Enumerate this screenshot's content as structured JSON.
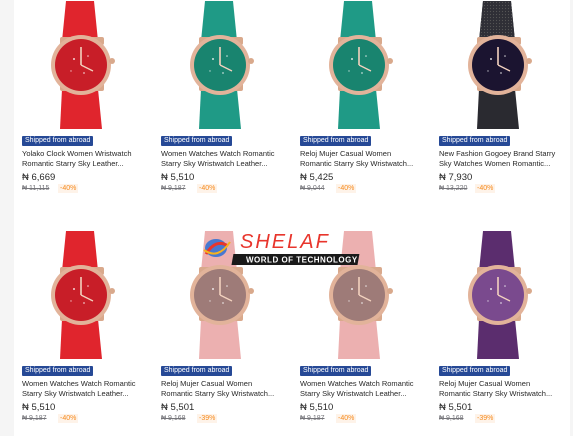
{
  "currency_symbol": "₦",
  "badge_label": "Shipped from abroad",
  "watermark": {
    "brand": "SHELAF",
    "tagline": "WORLD OF TECHNOLOGY"
  },
  "products": [
    {
      "title": "Yolako Clock Women Wristwatch Romantic Starry Sky Leather...",
      "price": "₦ 6,669",
      "old_price": "₦ 11,115",
      "discount": "-40%",
      "strap_color": "#e0252d",
      "dial_color": "#c81e28"
    },
    {
      "title": "Women Watches Watch Romantic Starry Sky Wristwatch Leather...",
      "price": "₦ 5,510",
      "old_price": "₦ 9,187",
      "discount": "-40%",
      "strap_color": "#1f9a86",
      "dial_color": "#19846f"
    },
    {
      "title": "Reloj Mujer Casual Women Romantic Starry Sky Wristwatch...",
      "price": "₦ 5,425",
      "old_price": "₦ 9,044",
      "discount": "-40%",
      "strap_color": "#1f9a86",
      "dial_color": "#19846f"
    },
    {
      "title": "New Fashion Gogoey Brand Starry Sky Watches Women Romantic...",
      "price": "₦ 7,930",
      "old_price": "₦ 13,220",
      "discount": "-40%",
      "strap_color": "#2a2a30",
      "dial_color": "#1b1430"
    },
    {
      "title": "Women Watches Watch Romantic Starry Sky Wristwatch Leather...",
      "price": "₦ 5,510",
      "old_price": "₦ 9,187",
      "discount": "-40%",
      "strap_color": "#e0252d",
      "dial_color": "#c81e28"
    },
    {
      "title": "Reloj Mujer Casual Women Romantic Starry Sky Wristwatch...",
      "price": "₦ 5,501",
      "old_price": "₦ 9,168",
      "discount": "-39%",
      "strap_color": "#ecb0b0",
      "dial_color": "#9e7b78"
    },
    {
      "title": "Women Watches Watch Romantic Starry Sky Wristwatch Leather...",
      "price": "₦ 5,510",
      "old_price": "₦ 9,187",
      "discount": "-40%",
      "strap_color": "#ecb0b0",
      "dial_color": "#9e7b78"
    },
    {
      "title": "Reloj Mujer Casual Women Romantic Starry Sky Wristwatch...",
      "price": "₦ 5,501",
      "old_price": "₦ 9,168",
      "discount": "-39%",
      "strap_color": "#5b2d6e",
      "dial_color": "#7a4a8e"
    }
  ]
}
